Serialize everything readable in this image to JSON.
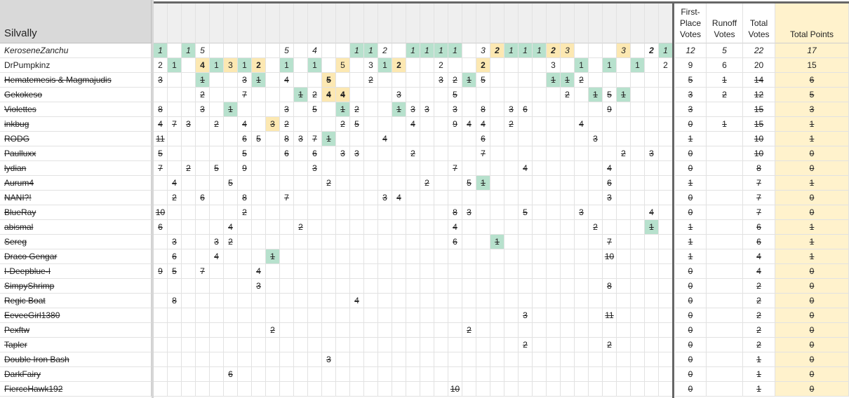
{
  "sheet": {
    "title": "Silvally",
    "headers": {
      "first_place": "First-Place Votes",
      "runoff": "Runoff Votes",
      "total_votes": "Total Votes",
      "total_points": "Total Points"
    },
    "vote_column_count": 37,
    "colors": {
      "green": "#b7e1cd",
      "yellow": "#fce8b2",
      "points_bg": "#fff2cc"
    },
    "rows": [
      {
        "name": "KeroseneZanchu",
        "style": "i",
        "stats": [
          "12",
          "5",
          "22",
          "17"
        ],
        "cells": [
          [
            0,
            "1",
            "g"
          ],
          [
            2,
            "1",
            "g"
          ],
          [
            3,
            "5",
            ""
          ],
          [
            9,
            "5",
            ""
          ],
          [
            11,
            "4",
            ""
          ],
          [
            14,
            "1",
            "g"
          ],
          [
            15,
            "1",
            "g"
          ],
          [
            16,
            "2",
            ""
          ],
          [
            18,
            "1",
            "g"
          ],
          [
            19,
            "1",
            "g"
          ],
          [
            20,
            "1",
            "g"
          ],
          [
            21,
            "1",
            "g"
          ],
          [
            23,
            "3",
            ""
          ],
          [
            24,
            "2",
            "yb"
          ],
          [
            25,
            "1",
            "g"
          ],
          [
            26,
            "1",
            "g"
          ],
          [
            27,
            "1",
            "g"
          ],
          [
            28,
            "2",
            "yb"
          ],
          [
            29,
            "3",
            "y"
          ],
          [
            33,
            "3",
            "y"
          ],
          [
            35,
            "2",
            "b"
          ],
          [
            36,
            "1",
            "g"
          ]
        ]
      },
      {
        "name": "DrPumpkinz",
        "style": "",
        "stats": [
          "9",
          "6",
          "20",
          "15"
        ],
        "cells": [
          [
            0,
            "2",
            ""
          ],
          [
            1,
            "1",
            "g"
          ],
          [
            3,
            "4",
            "yb"
          ],
          [
            4,
            "1",
            "g"
          ],
          [
            5,
            "3",
            "y"
          ],
          [
            6,
            "1",
            "g"
          ],
          [
            7,
            "2",
            "yb"
          ],
          [
            9,
            "1",
            "g"
          ],
          [
            11,
            "1",
            "g"
          ],
          [
            13,
            "5",
            "y"
          ],
          [
            15,
            "3",
            ""
          ],
          [
            16,
            "1",
            "g"
          ],
          [
            17,
            "2",
            "yb"
          ],
          [
            20,
            "2",
            ""
          ],
          [
            23,
            "2",
            "yb"
          ],
          [
            28,
            "3",
            ""
          ],
          [
            30,
            "1",
            "g"
          ],
          [
            32,
            "1",
            "g"
          ],
          [
            34,
            "1",
            "g"
          ],
          [
            36,
            "2",
            ""
          ]
        ]
      },
      {
        "name": "Hematemesis & Magmajudis",
        "style": "s",
        "stats": [
          "5",
          "1",
          "14",
          "6"
        ],
        "cells": [
          [
            0,
            "3",
            ""
          ],
          [
            3,
            "1",
            "g"
          ],
          [
            6,
            "3",
            ""
          ],
          [
            7,
            "1",
            "g"
          ],
          [
            9,
            "4",
            ""
          ],
          [
            12,
            "5",
            "yb"
          ],
          [
            15,
            "2",
            ""
          ],
          [
            20,
            "3",
            ""
          ],
          [
            21,
            "2",
            ""
          ],
          [
            22,
            "1",
            "g"
          ],
          [
            23,
            "5",
            ""
          ],
          [
            28,
            "1",
            "g"
          ],
          [
            29,
            "1",
            "g"
          ],
          [
            30,
            "2",
            ""
          ]
        ]
      },
      {
        "name": "Gekokeso",
        "style": "s",
        "stats": [
          "3",
          "2",
          "12",
          "5"
        ],
        "cells": [
          [
            3,
            "2",
            ""
          ],
          [
            6,
            "7",
            ""
          ],
          [
            10,
            "1",
            "g"
          ],
          [
            11,
            "2",
            ""
          ],
          [
            12,
            "4",
            "yb"
          ],
          [
            13,
            "4",
            "yb"
          ],
          [
            17,
            "3",
            ""
          ],
          [
            21,
            "5",
            ""
          ],
          [
            29,
            "2",
            ""
          ],
          [
            31,
            "1",
            "g"
          ],
          [
            32,
            "5",
            ""
          ],
          [
            33,
            "1",
            "g"
          ]
        ]
      },
      {
        "name": "Violettes",
        "style": "s",
        "stats": [
          "3",
          "",
          "15",
          "3"
        ],
        "cells": [
          [
            0,
            "8",
            ""
          ],
          [
            3,
            "3",
            ""
          ],
          [
            5,
            "1",
            "g"
          ],
          [
            9,
            "3",
            ""
          ],
          [
            11,
            "5",
            ""
          ],
          [
            13,
            "1",
            "g"
          ],
          [
            14,
            "2",
            ""
          ],
          [
            17,
            "1",
            "g"
          ],
          [
            18,
            "3",
            ""
          ],
          [
            19,
            "3",
            ""
          ],
          [
            21,
            "3",
            ""
          ],
          [
            23,
            "8",
            ""
          ],
          [
            25,
            "3",
            ""
          ],
          [
            26,
            "6",
            ""
          ],
          [
            32,
            "9",
            ""
          ]
        ]
      },
      {
        "name": "inkbug",
        "style": "s",
        "stats": [
          "0",
          "1",
          "15",
          "1"
        ],
        "cells": [
          [
            0,
            "4",
            ""
          ],
          [
            1,
            "7",
            ""
          ],
          [
            2,
            "3",
            ""
          ],
          [
            4,
            "2",
            ""
          ],
          [
            6,
            "4",
            ""
          ],
          [
            8,
            "3",
            "y"
          ],
          [
            9,
            "2",
            ""
          ],
          [
            13,
            "2",
            ""
          ],
          [
            14,
            "5",
            ""
          ],
          [
            18,
            "4",
            ""
          ],
          [
            21,
            "9",
            ""
          ],
          [
            22,
            "4",
            ""
          ],
          [
            23,
            "4",
            ""
          ],
          [
            25,
            "2",
            ""
          ],
          [
            30,
            "4",
            ""
          ]
        ]
      },
      {
        "name": "RODG",
        "style": "s",
        "stats": [
          "1",
          "",
          "10",
          "1"
        ],
        "cells": [
          [
            0,
            "11",
            ""
          ],
          [
            6,
            "6",
            ""
          ],
          [
            7,
            "5",
            ""
          ],
          [
            9,
            "8",
            ""
          ],
          [
            10,
            "3",
            ""
          ],
          [
            11,
            "7",
            ""
          ],
          [
            12,
            "1",
            "g"
          ],
          [
            16,
            "4",
            ""
          ],
          [
            23,
            "6",
            ""
          ],
          [
            31,
            "3",
            ""
          ]
        ]
      },
      {
        "name": "Paulluxx",
        "style": "s",
        "stats": [
          "0",
          "",
          "10",
          "0"
        ],
        "cells": [
          [
            0,
            "5",
            ""
          ],
          [
            6,
            "5",
            ""
          ],
          [
            9,
            "6",
            ""
          ],
          [
            11,
            "6",
            ""
          ],
          [
            13,
            "3",
            ""
          ],
          [
            14,
            "3",
            ""
          ],
          [
            18,
            "2",
            ""
          ],
          [
            23,
            "7",
            ""
          ],
          [
            33,
            "2",
            ""
          ],
          [
            35,
            "3",
            ""
          ]
        ]
      },
      {
        "name": "lydian",
        "style": "s",
        "stats": [
          "0",
          "",
          "8",
          "0"
        ],
        "cells": [
          [
            0,
            "7",
            ""
          ],
          [
            2,
            "2",
            ""
          ],
          [
            4,
            "5",
            ""
          ],
          [
            6,
            "9",
            ""
          ],
          [
            11,
            "3",
            ""
          ],
          [
            21,
            "7",
            ""
          ],
          [
            26,
            "4",
            ""
          ],
          [
            32,
            "4",
            ""
          ]
        ]
      },
      {
        "name": "Aurum4",
        "style": "s",
        "stats": [
          "1",
          "",
          "7",
          "1"
        ],
        "cells": [
          [
            1,
            "4",
            ""
          ],
          [
            5,
            "5",
            ""
          ],
          [
            12,
            "2",
            ""
          ],
          [
            19,
            "2",
            ""
          ],
          [
            22,
            "5",
            ""
          ],
          [
            23,
            "1",
            "g"
          ],
          [
            32,
            "6",
            ""
          ]
        ]
      },
      {
        "name": "NANI?!",
        "style": "s",
        "stats": [
          "0",
          "",
          "7",
          "0"
        ],
        "cells": [
          [
            1,
            "2",
            ""
          ],
          [
            3,
            "6",
            ""
          ],
          [
            6,
            "8",
            ""
          ],
          [
            9,
            "7",
            ""
          ],
          [
            16,
            "3",
            ""
          ],
          [
            17,
            "4",
            ""
          ],
          [
            32,
            "3",
            ""
          ]
        ]
      },
      {
        "name": "BlueRay",
        "style": "s",
        "stats": [
          "0",
          "",
          "7",
          "0"
        ],
        "cells": [
          [
            0,
            "10",
            ""
          ],
          [
            6,
            "2",
            ""
          ],
          [
            21,
            "8",
            ""
          ],
          [
            22,
            "3",
            ""
          ],
          [
            26,
            "5",
            ""
          ],
          [
            30,
            "3",
            ""
          ],
          [
            35,
            "4",
            ""
          ]
        ]
      },
      {
        "name": "abismal",
        "style": "s",
        "stats": [
          "1",
          "",
          "6",
          "1"
        ],
        "cells": [
          [
            0,
            "6",
            ""
          ],
          [
            5,
            "4",
            ""
          ],
          [
            10,
            "2",
            ""
          ],
          [
            21,
            "4",
            ""
          ],
          [
            31,
            "2",
            ""
          ],
          [
            35,
            "1",
            "g"
          ]
        ]
      },
      {
        "name": "Sereg",
        "style": "s",
        "stats": [
          "1",
          "",
          "6",
          "1"
        ],
        "cells": [
          [
            1,
            "3",
            ""
          ],
          [
            4,
            "3",
            ""
          ],
          [
            5,
            "2",
            ""
          ],
          [
            21,
            "6",
            ""
          ],
          [
            24,
            "1",
            "g"
          ],
          [
            32,
            "7",
            ""
          ]
        ]
      },
      {
        "name": "Draco Gengar",
        "style": "s",
        "stats": [
          "1",
          "",
          "4",
          "1"
        ],
        "cells": [
          [
            1,
            "6",
            ""
          ],
          [
            4,
            "4",
            ""
          ],
          [
            8,
            "1",
            "g"
          ],
          [
            32,
            "10",
            ""
          ]
        ]
      },
      {
        "name": "I-Deepblue-I",
        "style": "s",
        "stats": [
          "0",
          "",
          "4",
          "0"
        ],
        "cells": [
          [
            0,
            "9",
            ""
          ],
          [
            1,
            "5",
            ""
          ],
          [
            3,
            "7",
            ""
          ],
          [
            7,
            "4",
            ""
          ]
        ]
      },
      {
        "name": "SimpyShrimp",
        "style": "s",
        "stats": [
          "0",
          "",
          "2",
          "0"
        ],
        "cells": [
          [
            7,
            "3",
            ""
          ],
          [
            32,
            "8",
            ""
          ]
        ]
      },
      {
        "name": "Regic Boat",
        "style": "s",
        "stats": [
          "0",
          "",
          "2",
          "0"
        ],
        "cells": [
          [
            1,
            "8",
            ""
          ],
          [
            14,
            "4",
            ""
          ]
        ]
      },
      {
        "name": "EeveeGirl1380",
        "style": "s",
        "stats": [
          "0",
          "",
          "2",
          "0"
        ],
        "cells": [
          [
            26,
            "3",
            ""
          ],
          [
            32,
            "11",
            ""
          ]
        ]
      },
      {
        "name": "Pexftw",
        "style": "s",
        "stats": [
          "0",
          "",
          "2",
          "0"
        ],
        "cells": [
          [
            8,
            "2",
            ""
          ],
          [
            22,
            "2",
            ""
          ]
        ]
      },
      {
        "name": "Tapler",
        "style": "s",
        "stats": [
          "0",
          "",
          "2",
          "0"
        ],
        "cells": [
          [
            26,
            "2",
            ""
          ],
          [
            32,
            "2",
            ""
          ]
        ]
      },
      {
        "name": "Double Iron Bash",
        "style": "s",
        "stats": [
          "0",
          "",
          "1",
          "0"
        ],
        "cells": [
          [
            12,
            "3",
            ""
          ]
        ]
      },
      {
        "name": "DarkFairy",
        "style": "s",
        "stats": [
          "0",
          "",
          "1",
          "0"
        ],
        "cells": [
          [
            5,
            "6",
            ""
          ]
        ]
      },
      {
        "name": "FierceHawk192",
        "style": "s",
        "stats": [
          "0",
          "",
          "1",
          "0"
        ],
        "cells": [
          [
            21,
            "10",
            ""
          ]
        ]
      }
    ]
  }
}
